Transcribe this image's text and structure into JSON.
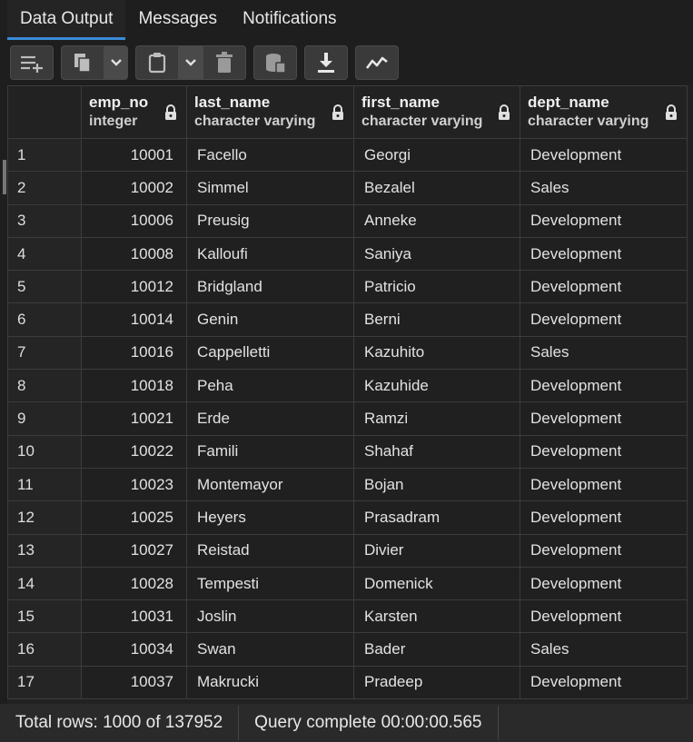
{
  "tabs": [
    {
      "label": "Data Output",
      "active": true
    },
    {
      "label": "Messages",
      "active": false
    },
    {
      "label": "Notifications",
      "active": false
    }
  ],
  "toolbar": {
    "icons": [
      "add-row-icon",
      "copy-icon",
      "chevron-down-icon",
      "paste-icon",
      "chevron-down-icon",
      "delete-icon",
      "save-data-icon",
      "download-icon",
      "graph-visualiser-icon"
    ]
  },
  "columns": [
    {
      "name": "emp_no",
      "type": "integer"
    },
    {
      "name": "last_name",
      "type": "character varying"
    },
    {
      "name": "first_name",
      "type": "character varying"
    },
    {
      "name": "dept_name",
      "type": "character varying"
    }
  ],
  "rows": [
    {
      "n": "1",
      "emp_no": "10001",
      "last_name": "Facello",
      "first_name": "Georgi",
      "dept_name": "Development"
    },
    {
      "n": "2",
      "emp_no": "10002",
      "last_name": "Simmel",
      "first_name": "Bezalel",
      "dept_name": "Sales"
    },
    {
      "n": "3",
      "emp_no": "10006",
      "last_name": "Preusig",
      "first_name": "Anneke",
      "dept_name": "Development"
    },
    {
      "n": "4",
      "emp_no": "10008",
      "last_name": "Kalloufi",
      "first_name": "Saniya",
      "dept_name": "Development"
    },
    {
      "n": "5",
      "emp_no": "10012",
      "last_name": "Bridgland",
      "first_name": "Patricio",
      "dept_name": "Development"
    },
    {
      "n": "6",
      "emp_no": "10014",
      "last_name": "Genin",
      "first_name": "Berni",
      "dept_name": "Development"
    },
    {
      "n": "7",
      "emp_no": "10016",
      "last_name": "Cappelletti",
      "first_name": "Kazuhito",
      "dept_name": "Sales"
    },
    {
      "n": "8",
      "emp_no": "10018",
      "last_name": "Peha",
      "first_name": "Kazuhide",
      "dept_name": "Development"
    },
    {
      "n": "9",
      "emp_no": "10021",
      "last_name": "Erde",
      "first_name": "Ramzi",
      "dept_name": "Development"
    },
    {
      "n": "10",
      "emp_no": "10022",
      "last_name": "Famili",
      "first_name": "Shahaf",
      "dept_name": "Development"
    },
    {
      "n": "11",
      "emp_no": "10023",
      "last_name": "Montemayor",
      "first_name": "Bojan",
      "dept_name": "Development"
    },
    {
      "n": "12",
      "emp_no": "10025",
      "last_name": "Heyers",
      "first_name": "Prasadram",
      "dept_name": "Development"
    },
    {
      "n": "13",
      "emp_no": "10027",
      "last_name": "Reistad",
      "first_name": "Divier",
      "dept_name": "Development"
    },
    {
      "n": "14",
      "emp_no": "10028",
      "last_name": "Tempesti",
      "first_name": "Domenick",
      "dept_name": "Development"
    },
    {
      "n": "15",
      "emp_no": "10031",
      "last_name": "Joslin",
      "first_name": "Karsten",
      "dept_name": "Development"
    },
    {
      "n": "16",
      "emp_no": "10034",
      "last_name": "Swan",
      "first_name": "Bader",
      "dept_name": "Sales"
    },
    {
      "n": "17",
      "emp_no": "10037",
      "last_name": "Makrucki",
      "first_name": "Pradeep",
      "dept_name": "Development"
    }
  ],
  "status": {
    "total_rows": "Total rows: 1000 of 137952",
    "query": "Query complete 00:00:00.565"
  },
  "colors": {
    "accent": "#3a8ad8",
    "background": "#1e1e1e"
  }
}
